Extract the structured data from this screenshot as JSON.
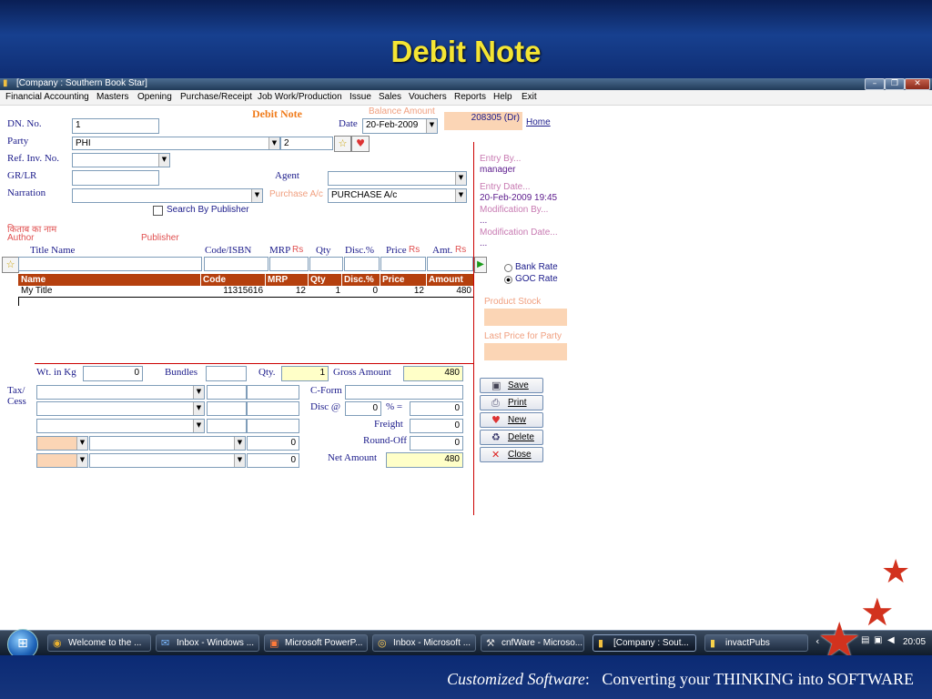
{
  "slide": {
    "title": "Debit Note",
    "footer_italic": "Customized Software",
    "footer_rest": ":   Converting your THINKING into SOFTWARE"
  },
  "window": {
    "title": "[Company : Southern Book Star]",
    "minimize": "–",
    "restore": "❐",
    "close": "✕"
  },
  "menu": [
    "Financial Accounting",
    "Masters",
    "Opening",
    "Purchase/Receipt",
    "Job Work/Production",
    "Issue",
    "Sales",
    "Vouchers",
    "Reports",
    "Help",
    "Exit"
  ],
  "form": {
    "heading": "Debit Note",
    "dn_no_label": "DN. No.",
    "dn_no_value": "1",
    "date_label": "Date",
    "date_value": "20-Feb-2009",
    "balance_label": "Balance Amount",
    "balance_value": "208305 (Dr)",
    "home_link": "Home",
    "party_label": "Party",
    "party_value": "PHI",
    "party_code": "2",
    "ref_label": "Ref. Inv. No.",
    "ref_value": "",
    "grlr_label": "GR/LR",
    "grlr_value": "",
    "agent_label": "Agent",
    "agent_value": "",
    "narration_label": "Narration",
    "narration_value": "",
    "purchase_label": "Purchase A/c",
    "purchase_value": "PURCHASE A/c",
    "search_by_publisher": "Search By Publisher",
    "hindi_label": "किताब का नाम",
    "author_label": "Author",
    "publisher_label": "Publisher",
    "col_title": "Title Name",
    "col_code": "Code/ISBN",
    "col_mrp": "MRP",
    "col_qty": "Qty",
    "col_disc": "Disc.%",
    "col_price": "Price",
    "col_amt": "Amt.",
    "rs": "Rs"
  },
  "grid": {
    "headers": [
      "Name",
      "Code",
      "MRP",
      "Qty",
      "Disc.%",
      "Price",
      "Amount"
    ],
    "rows": [
      [
        "My Title",
        "11315616",
        "12",
        "1",
        "0",
        "12",
        "480"
      ]
    ]
  },
  "side": {
    "entry_by_label": "Entry  By...",
    "entry_by_value": "manager",
    "entry_date_label": "Entry  Date...",
    "entry_date_value": "20-Feb-2009 19:45",
    "mod_by_label": "Modification  By...",
    "mod_by_value": "...",
    "mod_date_label": "Modification  Date...",
    "mod_date_value": "...",
    "bank_rate": "Bank Rate",
    "goc_rate": "GOC Rate",
    "product_stock_label": "Product Stock",
    "last_price_label": "Last Price for Party"
  },
  "totals": {
    "wt_label": "Wt. in Kg",
    "wt_value": "0",
    "bundles_label": "Bundles",
    "bundles_value": "",
    "qty_label": "Qty.",
    "qty_value": "1",
    "gross_label": "Gross Amount",
    "gross_value": "480",
    "tax_label": "Tax/\nCess",
    "cform_label": "C-Form",
    "disc_label": "Disc @",
    "disc_pct": "0",
    "pct_eq": "% =",
    "disc_value": "0",
    "freight_label": "Freight",
    "freight_value": "0",
    "roundoff_label": "Round-Off",
    "roundoff_value": "0",
    "net_label": "Net Amount",
    "net_value": "480",
    "row4_value": "0",
    "row5_value": "0"
  },
  "buttons": {
    "save": "Save",
    "print": "Print",
    "new": "New",
    "delete": "Delete",
    "close": "Close"
  },
  "taskbar": {
    "items": [
      "Welcome to the ...",
      "Inbox - Windows ...",
      "Microsoft PowerP...",
      "Inbox - Microsoft ...",
      "cnfWare - Microso...",
      "[Company : Sout...",
      "invactPubs"
    ],
    "clock": "20:05"
  },
  "colors": {
    "slide_title": "#f4e534",
    "grid_header": "#b5400e",
    "peach": "#fbd5b5",
    "yellow": "#ffffc8",
    "label_blue": "#1a1a8a"
  }
}
